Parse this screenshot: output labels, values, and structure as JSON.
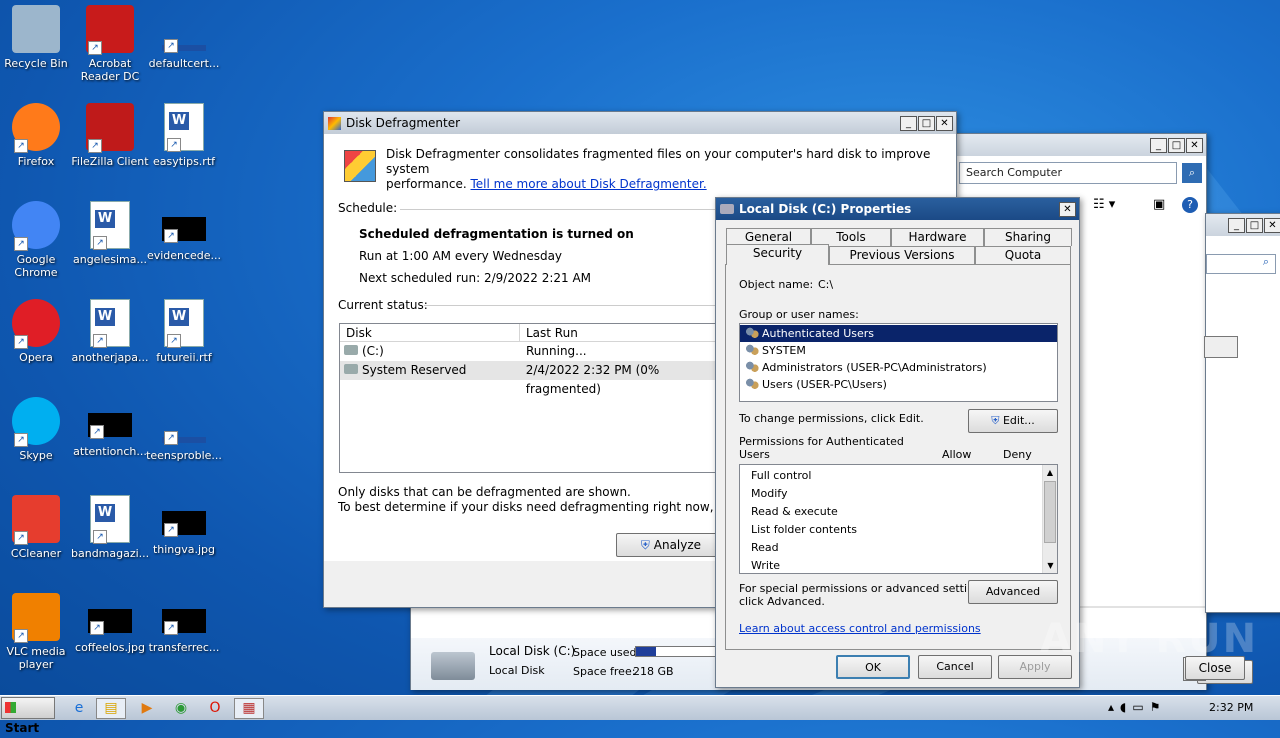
{
  "desktop": {
    "icons": [
      {
        "label": "Recycle Bin",
        "name": "recycle-bin-icon"
      },
      {
        "label": "Acrobat Reader DC",
        "name": "acrobat-reader-icon"
      },
      {
        "label": "defaultcert...",
        "name": "file-icon"
      },
      {
        "label": "Firefox",
        "name": "firefox-icon"
      },
      {
        "label": "FileZilla Client",
        "name": "filezilla-icon"
      },
      {
        "label": "easytips.rtf",
        "name": "word-document-icon"
      },
      {
        "label": "Google Chrome",
        "name": "chrome-icon"
      },
      {
        "label": "angelesima...",
        "name": "word-document-icon"
      },
      {
        "label": "evidencede...",
        "name": "image-file-icon"
      },
      {
        "label": "Opera",
        "name": "opera-icon"
      },
      {
        "label": "anotherjapa...",
        "name": "word-document-icon"
      },
      {
        "label": "futureii.rtf",
        "name": "word-document-icon"
      },
      {
        "label": "Skype",
        "name": "skype-icon"
      },
      {
        "label": "attentionch...",
        "name": "image-file-icon"
      },
      {
        "label": "teensproble...",
        "name": "file-icon"
      },
      {
        "label": "CCleaner",
        "name": "ccleaner-icon"
      },
      {
        "label": "bandmagazi...",
        "name": "word-document-icon"
      },
      {
        "label": "thingva.jpg",
        "name": "image-file-icon"
      },
      {
        "label": "VLC media player",
        "name": "vlc-icon"
      },
      {
        "label": "coffeelos.jpg",
        "name": "image-file-icon"
      },
      {
        "label": "transferrec...",
        "name": "image-file-icon"
      }
    ]
  },
  "back_window": {
    "search_placeholder": "Search Computer",
    "drive_name": "Local Disk (C:)",
    "drive_type": "Local Disk",
    "space_used_label": "Space used:",
    "space_free_label": "Space free:",
    "space_free_value": "218 GB",
    "space_used_fraction": 0.25,
    "close_label": "Close"
  },
  "defrag": {
    "title": "Disk Defragmenter",
    "intro": "Disk Defragmenter consolidates fragmented files on your computer's hard disk to improve system performance.",
    "intro_line1": "Disk Defragmenter consolidates fragmented files on your computer's hard disk to improve system",
    "intro_line2": "performance.",
    "learn_more": "Tell me more about Disk Defragmenter.",
    "schedule_label": "Schedule:",
    "schedule_status": "Scheduled defragmentation is turned on",
    "schedule_run": "Run at 1:00 AM every Wednesday",
    "schedule_next": "Next scheduled run: 2/9/2022 2:21 AM",
    "current_status_label": "Current status:",
    "col_disk": "Disk",
    "col_last_run": "Last Run",
    "rows": [
      {
        "disk": "(C:)",
        "last_run": "Running..."
      },
      {
        "disk": "System Reserved",
        "last_run": "2/4/2022 2:32 PM (0% fragmented)"
      }
    ],
    "note1": "Only disks that can be defragmented are shown.",
    "note2": "To best determine if your disks need defragmenting right now, you nee",
    "analyze_label": "Analyze"
  },
  "props": {
    "title": "Local Disk (C:) Properties",
    "tabs_row1": [
      "General",
      "Tools",
      "Hardware",
      "Sharing"
    ],
    "tabs_row2": [
      "Security",
      "Previous Versions",
      "Quota"
    ],
    "object_name_label": "Object name:",
    "object_name_value": "C:\\",
    "group_label": "Group or user names:",
    "users": [
      "Authenticated Users",
      "SYSTEM",
      "Administrators (USER-PC\\Administrators)",
      "Users (USER-PC\\Users)"
    ],
    "change_perm_text": "To change permissions, click Edit.",
    "edit_label": "Edit...",
    "perm_for_line1": "Permissions for Authenticated",
    "perm_for_line2": "Users",
    "allow_label": "Allow",
    "deny_label": "Deny",
    "permissions": [
      "Full control",
      "Modify",
      "Read & execute",
      "List folder contents",
      "Read",
      "Write"
    ],
    "special_line1": "For special permissions or advanced settings,",
    "special_line2": "click Advanced.",
    "advanced_label": "Advanced",
    "learn_link": "Learn about access control and permissions",
    "ok_label": "OK",
    "cancel_label": "Cancel",
    "apply_label": "Apply"
  },
  "taskbar": {
    "start_label": "Start",
    "clock": "2:32 PM"
  },
  "watermark": "ANY RUN",
  "colors": {
    "selection": "#0a246a",
    "link": "#0033cc"
  }
}
